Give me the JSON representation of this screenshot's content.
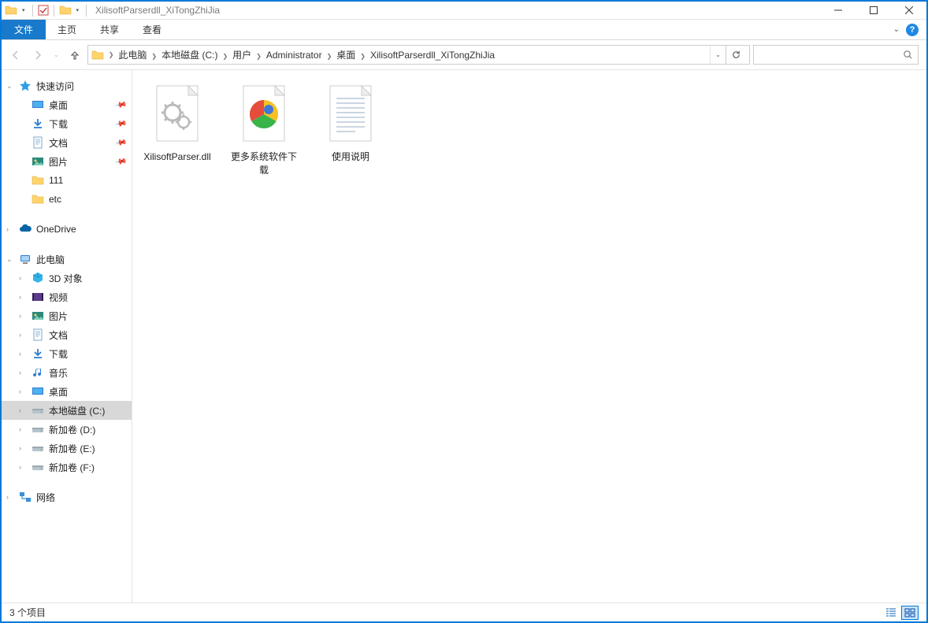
{
  "titlebar": {
    "title": "XilisoftParserdll_XiTongZhiJia"
  },
  "ribbon": {
    "file": "文件",
    "tabs": [
      "主页",
      "共享",
      "查看"
    ]
  },
  "breadcrumbs": [
    "此电脑",
    "本地磁盘 (C:)",
    "用户",
    "Administrator",
    "桌面",
    "XilisoftParserdll_XiTongZhiJia"
  ],
  "search": {
    "placeholder": ""
  },
  "sidebar": {
    "quickAccess": {
      "label": "快速访问",
      "items": [
        {
          "label": "桌面",
          "icon": "desktop",
          "pinned": true
        },
        {
          "label": "下载",
          "icon": "download",
          "pinned": true
        },
        {
          "label": "文档",
          "icon": "doc",
          "pinned": true
        },
        {
          "label": "图片",
          "icon": "pic",
          "pinned": true
        },
        {
          "label": "111",
          "icon": "folder",
          "pinned": false
        },
        {
          "label": "etc",
          "icon": "folder",
          "pinned": false
        }
      ]
    },
    "onedrive": {
      "label": "OneDrive"
    },
    "thispc": {
      "label": "此电脑",
      "items": [
        {
          "label": "3D 对象",
          "icon": "cube"
        },
        {
          "label": "视频",
          "icon": "video"
        },
        {
          "label": "图片",
          "icon": "pic"
        },
        {
          "label": "文档",
          "icon": "doc"
        },
        {
          "label": "下载",
          "icon": "download"
        },
        {
          "label": "音乐",
          "icon": "music"
        },
        {
          "label": "桌面",
          "icon": "desktop"
        },
        {
          "label": "本地磁盘 (C:)",
          "icon": "drive",
          "selected": true
        },
        {
          "label": "新加卷 (D:)",
          "icon": "drive"
        },
        {
          "label": "新加卷 (E:)",
          "icon": "drive"
        },
        {
          "label": "新加卷 (F:)",
          "icon": "drive"
        }
      ]
    },
    "network": {
      "label": "网络"
    }
  },
  "files": [
    {
      "name": "XilisoftParser.dll",
      "type": "dll"
    },
    {
      "name": "更多系统软件下载",
      "type": "link"
    },
    {
      "name": "使用说明",
      "type": "text"
    }
  ],
  "statusbar": {
    "count": "3 个项目"
  }
}
